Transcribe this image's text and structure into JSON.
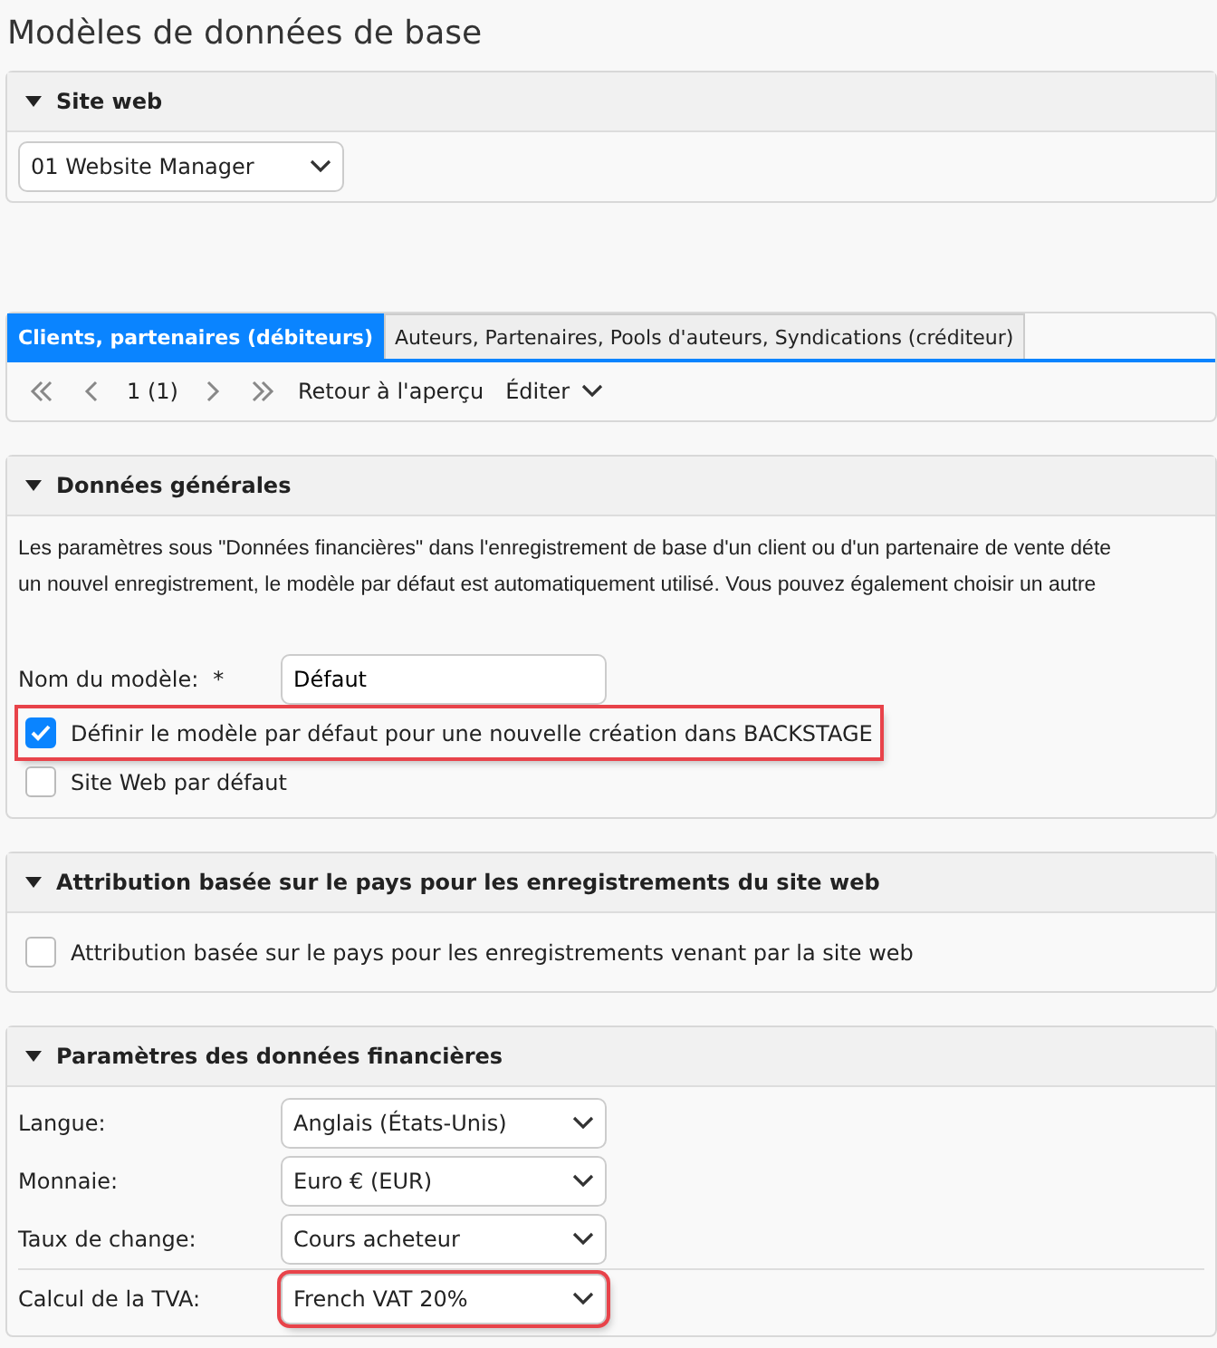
{
  "page_title": "Modèles de données de base",
  "site_panel": {
    "title": "Site web",
    "expanded": true,
    "select": {
      "value": "01 Website Manager"
    }
  },
  "tabs": [
    {
      "label": "Clients, partenaires (débiteurs)",
      "selected": true
    },
    {
      "label": "Auteurs, Partenaires, Pools d'auteurs, Syndications (créditeur)",
      "selected": false
    }
  ],
  "pager": {
    "page": "1 (1)",
    "back_link": "Retour à l'aperçu",
    "edit_menu": "Éditer"
  },
  "general_panel": {
    "title": "Données générales",
    "expanded": true,
    "description_lines": [
      "Les paramètres sous \"Données financières\" dans l'enregistrement de base d'un client ou d'un partenaire de vente déte",
      "un nouvel enregistrement, le modèle par défaut est automatiquement utilisé. Vous pouvez également choisir un autre"
    ],
    "name_field": {
      "label": "Nom du modèle:",
      "required_mark": "*",
      "value": "Défaut"
    },
    "checkboxes": [
      {
        "label": "Définir le modèle par défaut pour une nouvelle création dans BACKSTAGE",
        "checked": true,
        "highlighted": true
      },
      {
        "label": "Site Web par défaut",
        "checked": false,
        "highlighted": false
      }
    ]
  },
  "country_panel": {
    "title": "Attribution basée sur le pays pour les enregistrements du site web",
    "expanded": true,
    "checkboxes": [
      {
        "label": "Attribution basée sur le pays pour les enregistrements venant par la site web",
        "checked": false,
        "highlighted": false
      }
    ]
  },
  "finance_panel": {
    "title": "Paramètres des données financières",
    "expanded": true,
    "fields": [
      {
        "label": "Langue:",
        "value": "Anglais (États-Unis)",
        "highlighted": false
      },
      {
        "label": "Monnaie:",
        "value": "Euro € (EUR)",
        "highlighted": false
      },
      {
        "label": "Taux de change:",
        "value": "Cours acheteur",
        "highlighted": false
      },
      {
        "label": "Calcul de la TVA:",
        "value": "French VAT 20%",
        "highlighted": true
      }
    ]
  }
}
